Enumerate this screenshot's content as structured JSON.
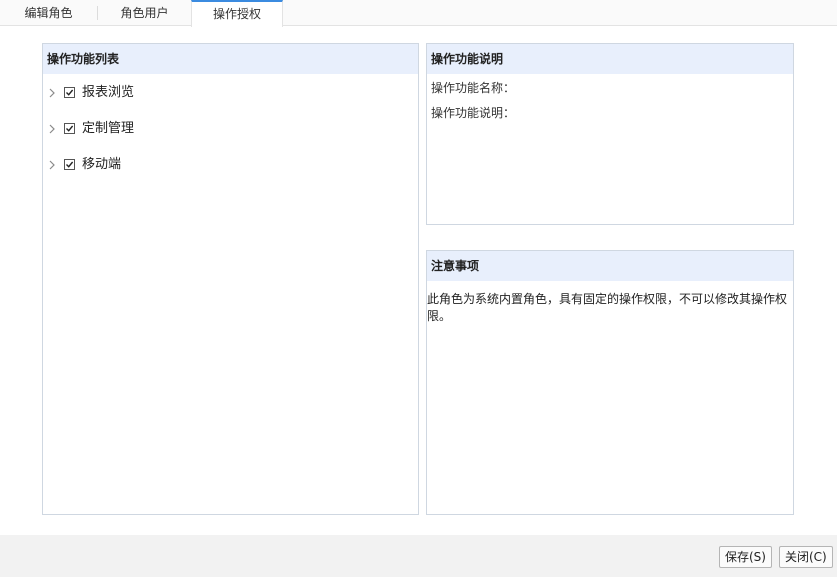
{
  "tabs": [
    {
      "label": "编辑角色"
    },
    {
      "label": "角色用户"
    },
    {
      "label": "操作授权"
    }
  ],
  "active_tab": "操作授权",
  "accent_color": "#3b8be0",
  "header_bg_color": "#e8effc",
  "left_panel": {
    "title": "操作功能列表",
    "items": [
      {
        "label": "报表浏览",
        "checked": true,
        "icon": "chevron-right-icon"
      },
      {
        "label": "定制管理",
        "checked": true,
        "icon": "chevron-right-icon"
      },
      {
        "label": "移动端",
        "checked": true,
        "icon": "chevron-right-icon"
      }
    ]
  },
  "desc_panel": {
    "title": "操作功能说明",
    "name_label": "操作功能名称：",
    "desc_label": "操作功能说明："
  },
  "notice_panel": {
    "title": "注意事项",
    "text": "此角色为系统内置角色，具有固定的操作权限，不可以修改其操作权限。"
  },
  "footer": {
    "save_label": "保存(S)",
    "close_label": "关闭(C)"
  }
}
